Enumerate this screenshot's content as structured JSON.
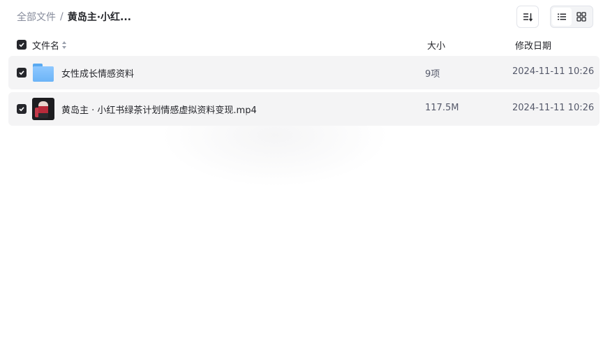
{
  "breadcrumb": {
    "root": "全部文件",
    "separator": "/",
    "current": "黄岛主·小红..."
  },
  "toolbar": {
    "sort_icon": "sort-icon",
    "list_view_icon": "list-view-icon",
    "grid_view_icon": "grid-view-icon",
    "active_view": "list"
  },
  "columns": {
    "name": "文件名",
    "size": "大小",
    "date": "修改日期"
  },
  "files": [
    {
      "name": "女性成长情感资料",
      "type": "folder",
      "icon": "folder-icon",
      "size": "9项",
      "date": "2024-11-11 10:26",
      "checked": true
    },
    {
      "name": "黄岛主 · 小红书绿茶计划情感虚拟资料变现.mp4",
      "type": "video",
      "icon": "video-thumbnail",
      "size": "117.5M",
      "date": "2024-11-11 10:26",
      "checked": true
    }
  ],
  "colors": {
    "accent": "#25262b",
    "row_bg": "#f4f4f5",
    "muted_text": "#878c9c",
    "folder_blue": "#6cb4f7"
  }
}
